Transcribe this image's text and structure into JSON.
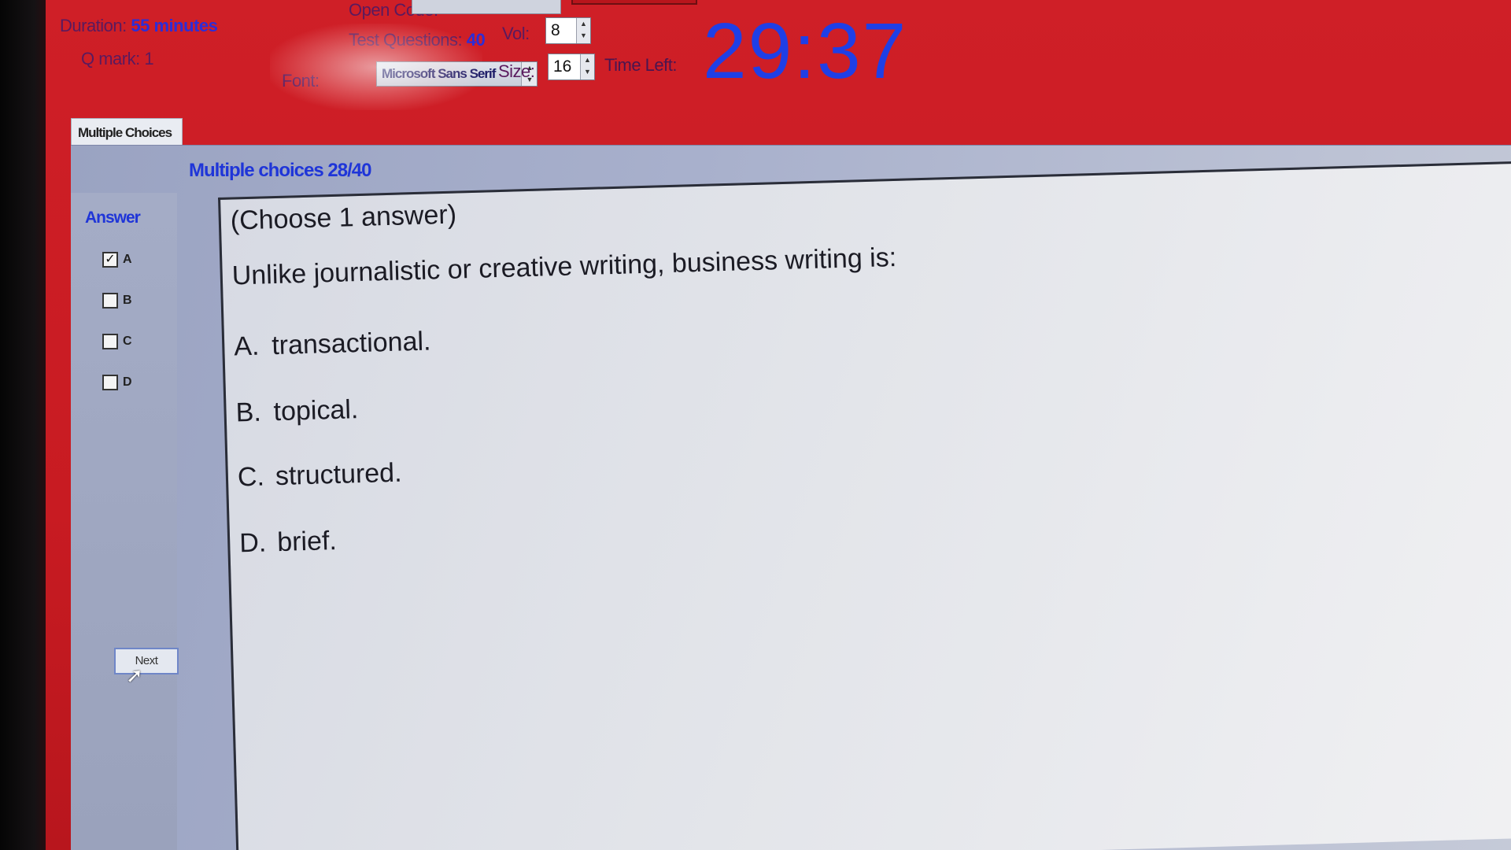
{
  "header": {
    "duration_label": "Duration:",
    "duration_value": "55 minutes",
    "qmark_label": "Q mark:",
    "qmark_value": "1",
    "open_code_label": "Open Code:",
    "test_questions_label": "Test Questions:",
    "test_questions_value": "40",
    "font_label": "Font:",
    "font_value": "Microsoft Sans Serif",
    "vol_label": "Vol:",
    "vol_value": "8",
    "size_label": "Size:",
    "size_value": "16",
    "time_left_label": "Time Left:",
    "time_left_value": "29:37"
  },
  "tab": {
    "label": "Multiple Choices"
  },
  "panel": {
    "counter": "Multiple choices 28/40",
    "answer_label": "Answer",
    "answers": [
      {
        "letter": "A",
        "checked": true,
        "mark": "✓"
      },
      {
        "letter": "B",
        "checked": false,
        "mark": ""
      },
      {
        "letter": "C",
        "checked": false,
        "mark": ""
      },
      {
        "letter": "D",
        "checked": false,
        "mark": ""
      }
    ],
    "next_label": "Next"
  },
  "question": {
    "instruction": "(Choose 1 answer)",
    "stem": "Unlike journalistic or creative writing, business writing is:",
    "options": [
      {
        "letter": "A.",
        "text": "transactional."
      },
      {
        "letter": "B.",
        "text": "topical."
      },
      {
        "letter": "C.",
        "text": "structured."
      },
      {
        "letter": "D.",
        "text": "brief."
      }
    ]
  },
  "colors": {
    "header_bg": "#cf1f27",
    "timer": "#1f3fe6",
    "accent_blue": "#1f35d8",
    "panel_bg": "#a8b0cc",
    "question_bg": "#e3e5ea"
  }
}
